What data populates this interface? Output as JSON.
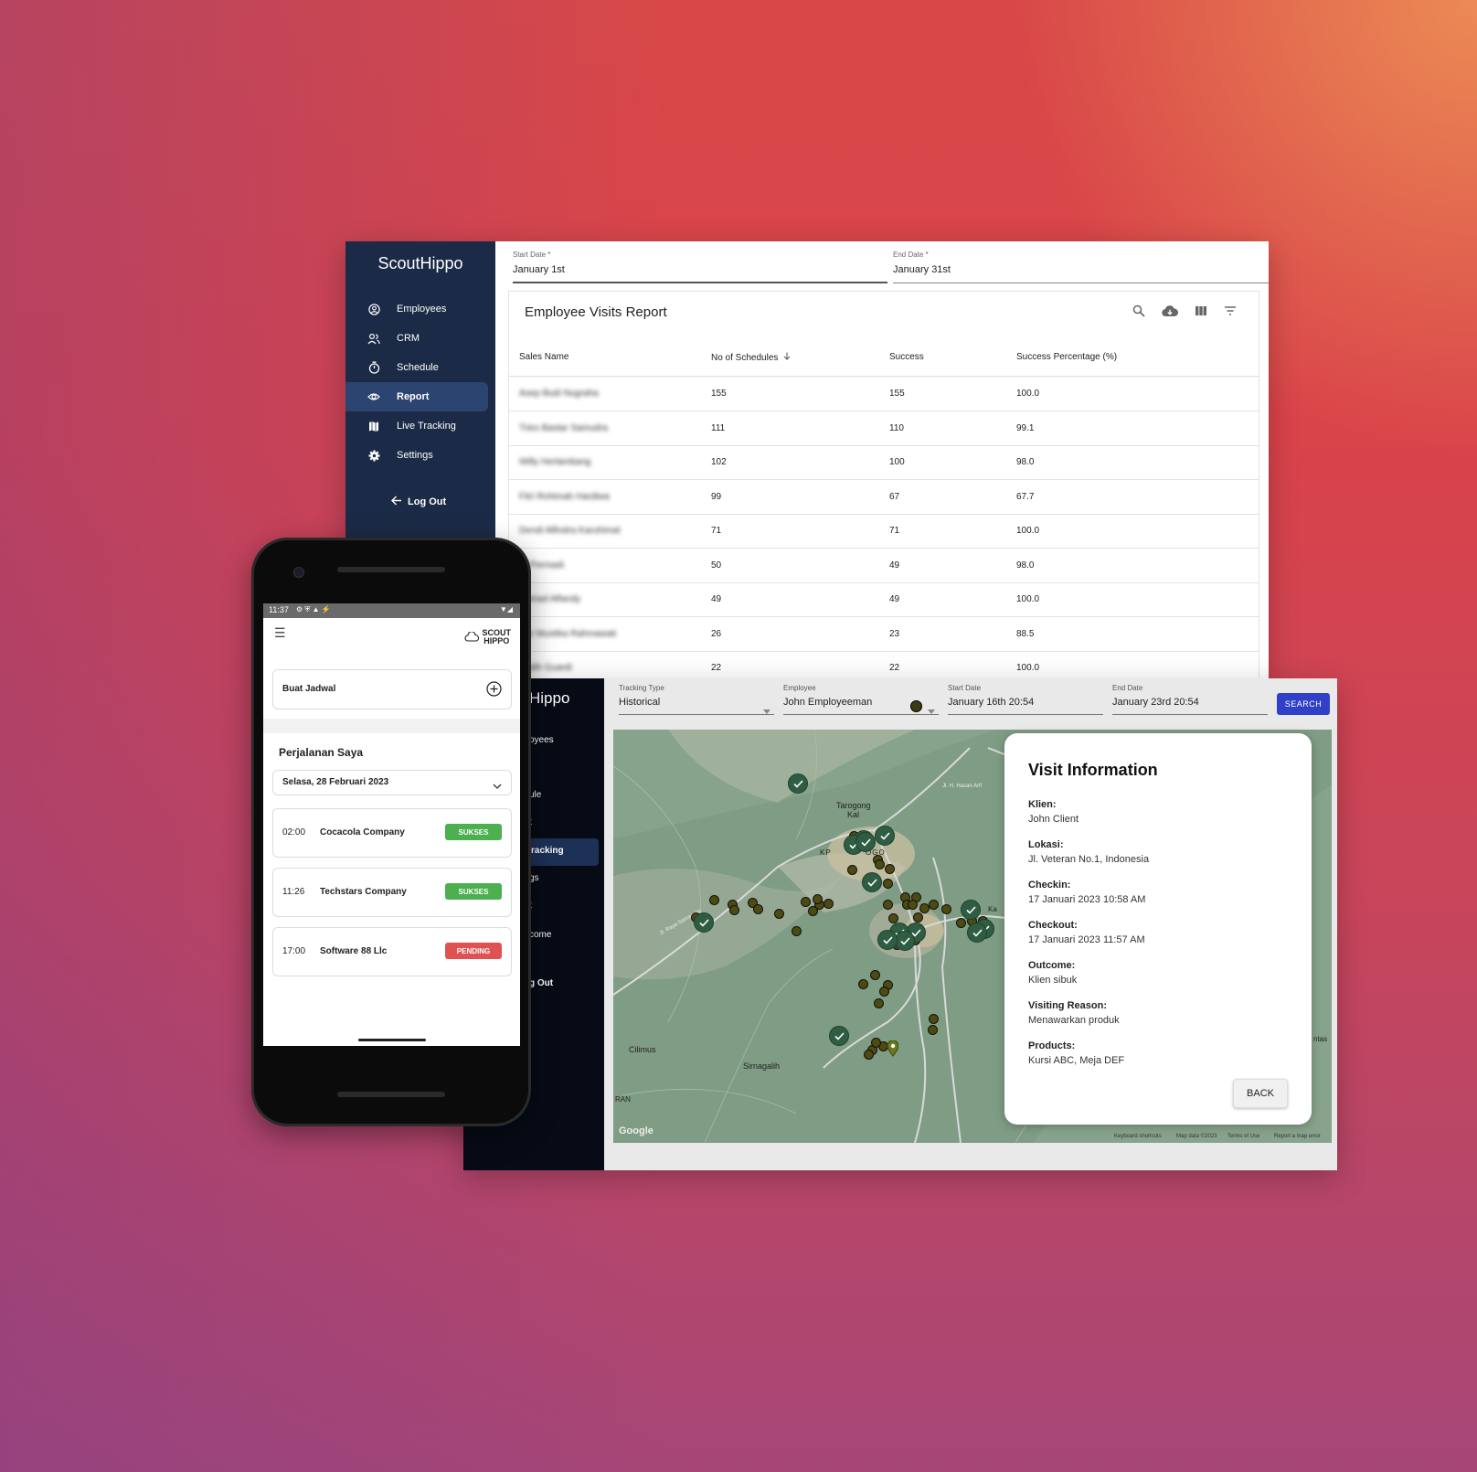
{
  "report_app": {
    "brand": "ScoutHippo",
    "nav": [
      {
        "label": "Employees",
        "icon": "account-circle-icon"
      },
      {
        "label": "CRM",
        "icon": "people-icon"
      },
      {
        "label": "Schedule",
        "icon": "timer-icon"
      },
      {
        "label": "Report",
        "icon": "eye-icon",
        "active": true
      },
      {
        "label": "Live Tracking",
        "icon": "map-icon"
      },
      {
        "label": "Settings",
        "icon": "gear-icon"
      }
    ],
    "logout_label": "Log Out",
    "start_date": {
      "label": "Start Date *",
      "value": "January 1st"
    },
    "end_date": {
      "label": "End Date *",
      "value": "January 31st"
    },
    "report_title": "Employee Visits Report",
    "columns": [
      "Sales Name",
      "No of Schedules",
      "Success",
      "Success Percentage (%)"
    ],
    "rows": [
      {
        "name": "Asep Budi Nugraha",
        "schedules": "155",
        "success": "155",
        "pct": "100.0"
      },
      {
        "name": "Tries Bastar Samudra",
        "schedules": "111",
        "success": "110",
        "pct": "99.1"
      },
      {
        "name": "Willy Herlambang",
        "schedules": "102",
        "success": "100",
        "pct": "98.0"
      },
      {
        "name": "Fitri Rohimah Hardiwa",
        "schedules": "99",
        "success": "67",
        "pct": "67.7"
      },
      {
        "name": "Dendi Alfindra Karuhimat",
        "schedules": "71",
        "success": "71",
        "pct": "100.0"
      },
      {
        "name": "Ai Permadi",
        "schedules": "50",
        "success": "49",
        "pct": "98.0"
      },
      {
        "name": "Ahmad Alfandy",
        "schedules": "49",
        "success": "49",
        "pct": "100.0"
      },
      {
        "name": "Nur Mustika Rahmawati",
        "schedules": "26",
        "success": "23",
        "pct": "88.5"
      },
      {
        "name": "Fadih Guardi",
        "schedules": "22",
        "success": "22",
        "pct": "100.0"
      }
    ]
  },
  "tracking_app": {
    "brand_partial": "Hippo",
    "nav_partial": [
      "oyees",
      "ule",
      "t",
      "racking",
      "gs",
      "t",
      "come"
    ],
    "logout_partial": "g Out",
    "tracking_type": {
      "label": "Tracking Type",
      "value": "Historical"
    },
    "employee": {
      "label": "Employee",
      "value": "John Employeeman"
    },
    "start_date": {
      "label": "Start Date",
      "value": "January 16th 20:54"
    },
    "end_date": {
      "label": "End Date",
      "value": "January 23rd 20:54"
    },
    "search_label": "SEARCH",
    "map_labels": {
      "t1": "Tarogong",
      "t2": "Kal",
      "t3": "KP",
      "t4": "OGO",
      "t5": "Cilimus",
      "t6": "Sirnagalih",
      "t7": "RAN",
      "t8": "Ka",
      "t9": "ntas",
      "t10": "Jl. H. Hasan Arif",
      "t11": "Jl. Raya Samarang"
    },
    "map_footer": [
      "Keyboard shortcuts",
      "Map data ©2023",
      "Terms of Use",
      "Report a map error"
    ],
    "google_label": "Google",
    "visit": {
      "title": "Visit Information",
      "fields": [
        {
          "label": "Klien:",
          "value": "John Client"
        },
        {
          "label": "Lokasi:",
          "value": "Jl. Veteran No.1, Indonesia"
        },
        {
          "label": "Checkin:",
          "value": "17 Januari 2023 10:58 AM"
        },
        {
          "label": "Checkout:",
          "value": "17 Januari 2023 11:57 AM"
        },
        {
          "label": "Outcome:",
          "value": "Klien sibuk"
        },
        {
          "label": "Visiting Reason:",
          "value": "Menawarkan produk"
        },
        {
          "label": "Products:",
          "value": "Kursi ABC, Meja DEF"
        }
      ],
      "back_label": "BACK"
    }
  },
  "mobile_app": {
    "time": "11:37",
    "logo_line1": "SCOUT",
    "logo_line2": "HIPPO",
    "create_schedule": "Buat Jadwal",
    "section_title": "Perjalanan Saya",
    "date_select": "Selasa, 28 Februari 2023",
    "trips": [
      {
        "time": "02:00",
        "company": "Cocacola Company",
        "status": "SUKSES",
        "color": "#4caf50"
      },
      {
        "time": "11:26",
        "company": "Techstars Company",
        "status": "SUKSES",
        "color": "#4caf50"
      },
      {
        "time": "17:00",
        "company": "Software 88 Llc",
        "status": "PENDING",
        "color": "#e05252"
      }
    ]
  }
}
